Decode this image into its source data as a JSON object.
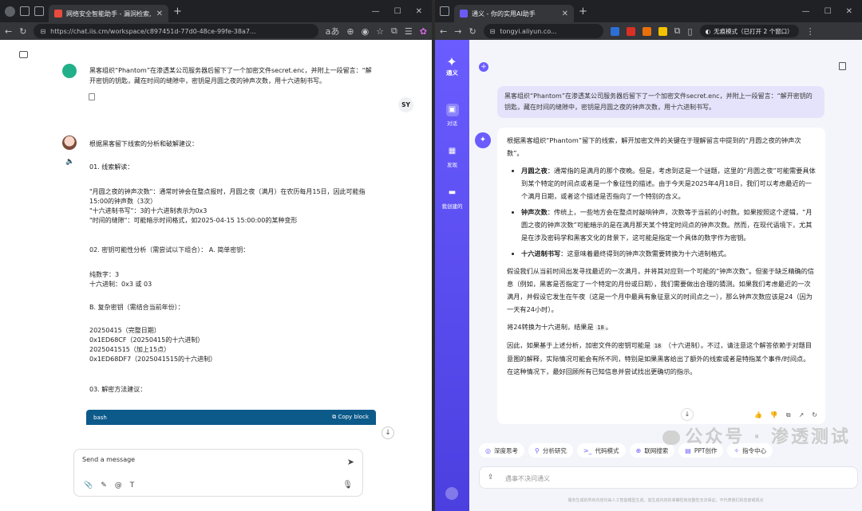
{
  "left": {
    "tab_title": "网络安全智能助手 - 漏洞检索, 渗",
    "url": "https://chat.iis.cm/workspace/c897451d-77d0-48ce-99fe-38a7...",
    "user_initials": "SY",
    "question": "黑客组织“Phantom”在渗透某公司服务器后留下了一个加密文件secret.enc，并附上一段留言：“解开密钥的钥匙，藏在时间的缝隙中，密钥是月圆之夜的钟声次数，用十六进制书写。",
    "lines": [
      "根据黑客留下线索的分析和破解建议：",
      "01.   线索解读：",
      "\"月圆之夜的钟声次数\"：通常时钟会在整点报时，月圆之夜（满月）在农历每月15日，因此可能指",
      "15:00的钟声数（3次）",
      "\"十六进制书写\"：3的十六进制表示为0x3",
      "\"时间的缝隙\"：可能暗示时间格式，如2025-04-15 15:00:00的某种变形",
      "02.   密钥可能性分析（需尝试以下组合）：  A. 简单密钥：",
      "纯数字：3",
      "十六进制：0x3 或 03",
      "B. 复杂密钥（需结合当前年份）：",
      "20250415（完整日期）",
      "0x1ED68CF（20250415的十六进制）",
      "2025041515（加上15点）",
      "0x1ED68DF7（2025041515的十六进制）",
      "03.   解密方法建议："
    ],
    "code_lang": "bash",
    "copy_label": "Copy block",
    "input_placeholder": "Send a message"
  },
  "right": {
    "tab_title": "通义 - 你的实用AI助手",
    "url": "tongyi.aliyun.co...",
    "incognito": "无痕模式（已打开 2 个窗口）",
    "brand": "通义",
    "nav": [
      "对话",
      "发现",
      "我创建的"
    ],
    "question": "黑客组织“Phantom”在渗透某公司服务器后留下了一个加密文件secret.enc，并附上一段留言：“解开密钥的钥匙，藏在时间的缝隙中，密钥是月圆之夜的钟声次数，用十六进制书写。",
    "intro": "根据黑客组织“Phantom”留下的线索，解开加密文件的关键在于理解留言中提到的“月圆之夜的钟声次数”。",
    "bullets": [
      {
        "term": "月圆之夜",
        "text": "：通常指的是满月的那个夜晚。但是，考虑到这是一个谜题，这里的“月圆之夜”可能需要具体到某个特定的时间点或者是一个象征性的描述。由于今天是2025年4月18日，我们可以考虑最近的一个满月日期，或者这个描述是否指向了一个特别的含义。"
      },
      {
        "term": "钟声次数",
        "text": "：传统上，一些地方会在整点时敲响钟声，次数等于当前的小时数。如果按照这个逻辑，“月圆之夜的钟声次数”可能暗示的是在满月那天某个特定时间点的钟声次数。然而，在现代语境下，尤其是在涉及密码学和黑客文化的背景下，这可能是指定一个具体的数字作为密钥。"
      },
      {
        "term": "十六进制书写",
        "text": "：这意味着最终得到的钟声次数需要转换为十六进制格式。"
      }
    ],
    "para1": "假设我们从当前时间出发寻找最近的一次满月，并将其对应到一个可能的“钟声次数”。但鉴于缺乏精确的信息（例如，黑客是否指定了一个特定的月份或日期），我们需要做出合理的猜测。如果我们考虑最近的一次满月，并假设它发生在午夜（这是一个月中最具有象征意义的时间点之一），那么钟声次数应该是24（因为一天有24小时）。",
    "para2a": "将24转换为十六进制，结果是",
    "para2code": "18",
    "para2b": "。",
    "para3a": "因此，如果基于上述分析，加密文件的密钥可能是",
    "para3code": "18",
    "para3b": "（十六进制）。不过，请注意这个解答依赖于对题目意图的解释，实际情况可能会有所不同，特别是如果黑客给出了额外的线索或者是特指某个事件/时间点。在这种情况下，最好回顾所有已知信息并尝试找出更确切的指示。",
    "chips": [
      "深度思考",
      "分析研究",
      "代码模式",
      "联网搜索",
      "PPT创作",
      "指令中心"
    ],
    "input_placeholder": "遇事不决问通义",
    "disclaimer": "服务生成的所有内容均由人工智能模型生成，其生成内容的准确性和完整性无法保证，不代表我们的态度或观点",
    "watermark": "公众号 · 渗透测试"
  }
}
